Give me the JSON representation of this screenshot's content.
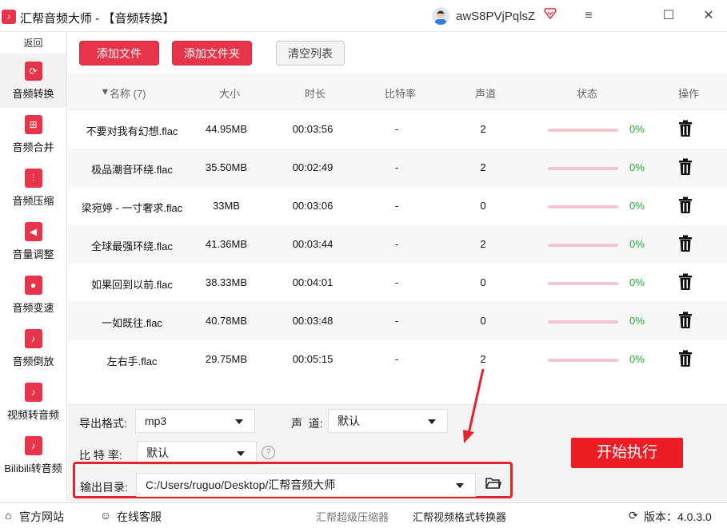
{
  "window": {
    "app_name": "汇帮音频大师",
    "separator": " - ",
    "section": "【音频转换】",
    "user_name": "awS8PVjPqlsZ",
    "controls": {
      "menu": "≡",
      "maximize": "☐",
      "close": "✕"
    }
  },
  "sidebar": {
    "back_label": "返回",
    "items": [
      {
        "label": "音频转换",
        "icon": "audio-convert-icon",
        "active": true
      },
      {
        "label": "音频合并",
        "icon": "audio-merge-icon",
        "active": false
      },
      {
        "label": "音频压缩",
        "icon": "audio-compress-icon",
        "active": false
      },
      {
        "label": "音量调整",
        "icon": "volume-icon",
        "active": false
      },
      {
        "label": "音频变速",
        "icon": "microphone-icon",
        "active": false
      },
      {
        "label": "音频倒放",
        "icon": "music-note-icon",
        "active": false
      },
      {
        "label": "视频转音频",
        "icon": "music-note-icon",
        "active": false
      },
      {
        "label": "Bilibili转音频",
        "icon": "music-note-icon",
        "active": false
      }
    ]
  },
  "toolbar": {
    "add_file": "添加文件",
    "add_folder": "添加文件夹",
    "clear_list": "清空列表"
  },
  "table": {
    "headers": {
      "name": "名称 (7)",
      "size": "大小",
      "duration": "时长",
      "bitrate": "比特率",
      "channels": "声道",
      "status": "状态",
      "actions": "操作"
    },
    "rows": [
      {
        "name": "不要对我有幻想.flac",
        "size": "44.95MB",
        "duration": "00:03:56",
        "bitrate": "-",
        "channels": "2",
        "progress": "0%"
      },
      {
        "name": "极品潮音环绕.flac",
        "size": "35.50MB",
        "duration": "00:02:49",
        "bitrate": "-",
        "channels": "2",
        "progress": "0%"
      },
      {
        "name": "梁宛婷 - 一寸奢求.flac",
        "size": "33MB",
        "duration": "00:03:06",
        "bitrate": "-",
        "channels": "0",
        "progress": "0%"
      },
      {
        "name": "全球最强环绕.flac",
        "size": "41.36MB",
        "duration": "00:03:44",
        "bitrate": "-",
        "channels": "2",
        "progress": "0%"
      },
      {
        "name": "如果回到以前.flac",
        "size": "38.33MB",
        "duration": "00:04:01",
        "bitrate": "-",
        "channels": "0",
        "progress": "0%"
      },
      {
        "name": "一如既往.flac",
        "size": "40.78MB",
        "duration": "00:03:48",
        "bitrate": "-",
        "channels": "0",
        "progress": "0%"
      },
      {
        "name": "左右手.flac",
        "size": "29.75MB",
        "duration": "00:05:15",
        "bitrate": "-",
        "channels": "2",
        "progress": "0%"
      }
    ]
  },
  "settings": {
    "format_label": "导出格式:",
    "format_value": "mp3",
    "channel_label": "声  道:",
    "channel_value": "默认",
    "bitrate_label": "比 特 率:",
    "bitrate_value": "默认",
    "output_label": "输出目录:",
    "output_value": "C:/Users/ruguo/Desktop/汇帮音频大师",
    "start_label": "开始执行",
    "help_glyph": "?"
  },
  "bottom": {
    "website": "官方网站",
    "support": "在线客服",
    "compressor": "汇帮超级压缩器",
    "video_converter": "汇帮视频格式转换器",
    "version": "版本：4.0.3.0"
  },
  "colors": {
    "brand_red": "#e8344a",
    "progress_green": "#25a539",
    "annotation_red": "#e0252b"
  }
}
